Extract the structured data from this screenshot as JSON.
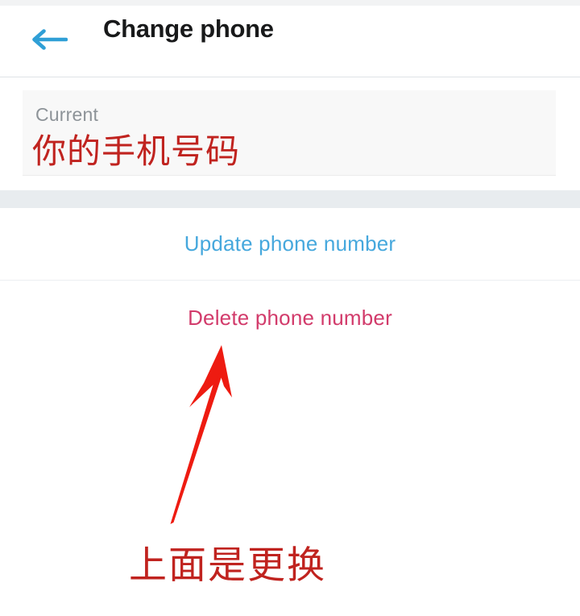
{
  "header": {
    "title": "Change phone",
    "back_icon": "arrow-left-icon",
    "back_icon_color": "#2f9fd6",
    "title_color": "#18191a"
  },
  "form": {
    "current_field": {
      "label": "Current",
      "label_color": "#8d9398",
      "background": "#f8f8f8",
      "annotation_overlay": "你的手机号码",
      "annotation_color": "#c0231f"
    }
  },
  "actions": [
    {
      "id": "update-phone-number",
      "label": "Update phone number",
      "color": "#46a8dd"
    },
    {
      "id": "delete-phone-number",
      "label": "Delete phone number",
      "color": "#d23b6b"
    }
  ],
  "annotations": {
    "arrow": {
      "icon": "hand-drawn-up-arrow-icon",
      "color": "#ee1b11",
      "points_to": "Delete phone number"
    },
    "caption": {
      "text": "上面是更换",
      "color": "#c0231f"
    }
  },
  "separator_band_color": "#e8ecef"
}
